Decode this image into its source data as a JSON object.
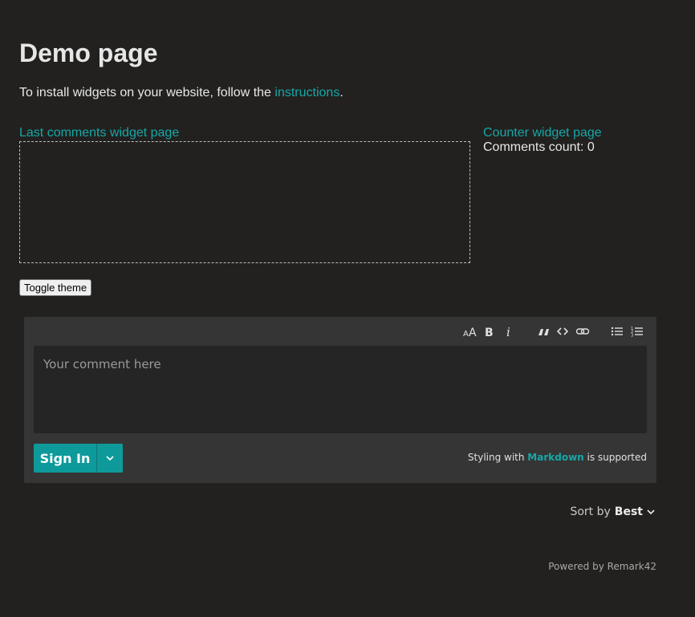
{
  "page": {
    "title": "Demo page",
    "intro_prefix": "To install widgets on your website, follow the ",
    "intro_link": "instructions",
    "intro_suffix": "."
  },
  "last_comments": {
    "link_label": "Last comments widget page"
  },
  "counter": {
    "link_label": "Counter widget page",
    "count_text": "Comments count: 0"
  },
  "toggle_theme_label": "Toggle theme",
  "editor": {
    "toolbar": [
      {
        "name": "heading-icon",
        "glyph": "AA"
      },
      {
        "name": "bold-icon",
        "glyph": "B"
      },
      {
        "name": "italic-icon",
        "glyph": "i"
      },
      {
        "name": "quote-icon",
        "glyph": "“"
      },
      {
        "name": "code-icon",
        "glyph": "<>"
      },
      {
        "name": "link-icon",
        "glyph": "link"
      },
      {
        "name": "unordered-list-icon",
        "glyph": "list"
      },
      {
        "name": "ordered-list-icon",
        "glyph": "olist"
      }
    ],
    "placeholder": "Your comment here",
    "signin_label": "Sign In",
    "markdown_prefix": "Styling with ",
    "markdown_link": "Markdown",
    "markdown_suffix": " is supported"
  },
  "sort": {
    "label": "Sort by",
    "value": "Best"
  },
  "footer": {
    "powered": "Powered by Remark42"
  },
  "colors": {
    "accent": "#16a7a7",
    "background": "#22211f",
    "widget_bg": "#353535"
  }
}
